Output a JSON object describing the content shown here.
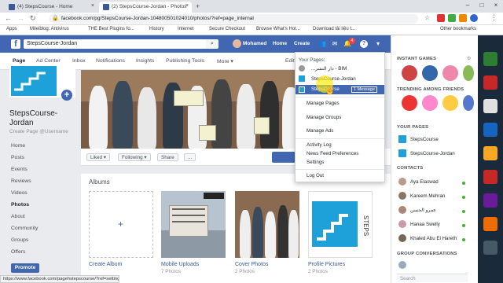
{
  "browser": {
    "tabs": [
      {
        "label": "(4) StepsCourse - Home",
        "active": false
      },
      {
        "label": "(2) StepsCourse-Jordan - Photos",
        "active": true
      }
    ],
    "url": "facebook.com/pg/StepsCourse-Jordan-104800501024010/photos/?ref=page_internal",
    "bookmarks": [
      "Apps",
      "Mileiblog: Antivirus",
      "THE Best Plugins fo...",
      "History",
      "Internet",
      "Secure Checkout",
      "Browse What's Hot...",
      "Download tải liệu t...",
      "Other bookmarks"
    ]
  },
  "fbbar": {
    "search_value": "StepsCourse-Jordan",
    "user": "Mohamed",
    "home": "Home",
    "create": "Create",
    "notif_count": "4"
  },
  "pagenav": [
    "Page",
    "Ad Center",
    "Inbox",
    "Notifications",
    "Insights",
    "Publishing Tools",
    "More ▾",
    "Edit"
  ],
  "page": {
    "name": "StepsCourse-Jordan",
    "username": "Create Page @Username"
  },
  "leftnav": [
    "Home",
    "Posts",
    "Events",
    "Reviews",
    "Videos",
    "Photos",
    "About",
    "Community",
    "Groups",
    "Offers"
  ],
  "leftnav_selected": "Photos",
  "promote": "Promote",
  "actions": [
    "Liked ▾",
    "Following ▾",
    "Share",
    "..."
  ],
  "albums": {
    "title": "Albums",
    "items": [
      {
        "label": "Create Album",
        "count": ""
      },
      {
        "label": "Mobile Uploads",
        "count": "7 Photos"
      },
      {
        "label": "Cover Photos",
        "count": "2 Photos"
      },
      {
        "label": "Profile Pictures",
        "count": "2 Photos"
      }
    ]
  },
  "dropdown": {
    "header": "Your Pages:",
    "pages": [
      "...دار النشر - BIM",
      "StepsCourse-Jordan",
      "StepsCourse"
    ],
    "message_badge": "1 Message",
    "group1": [
      "Manage Pages",
      "Manage Groups",
      "Manage Ads"
    ],
    "group2": [
      "Activity Log",
      "News Feed Preferences",
      "Settings"
    ],
    "logout": "Log Out"
  },
  "right": {
    "instant_games": "INSTANT GAMES",
    "trending": "TRENDING AMONG FRIENDS",
    "your_pages": "YOUR PAGES",
    "pages": [
      "StepsCourse",
      "StepsCourse-Jordan"
    ],
    "contacts": "CONTACTS",
    "contact_list": [
      "Aya Elaswad",
      "Kareem Mehran",
      "عمرو الحسن",
      "Hanaa Swelly",
      "Khaled Abu El Hareth"
    ],
    "group_conv": "GROUP CONVERSATIONS",
    "search": "Search"
  },
  "status_url": "https://www.facebook.com/pagehstepscourse/?ref=settings",
  "colors": {
    "fb_blue": "#4267b2",
    "link": "#385898",
    "bg": "#e9ebee"
  }
}
